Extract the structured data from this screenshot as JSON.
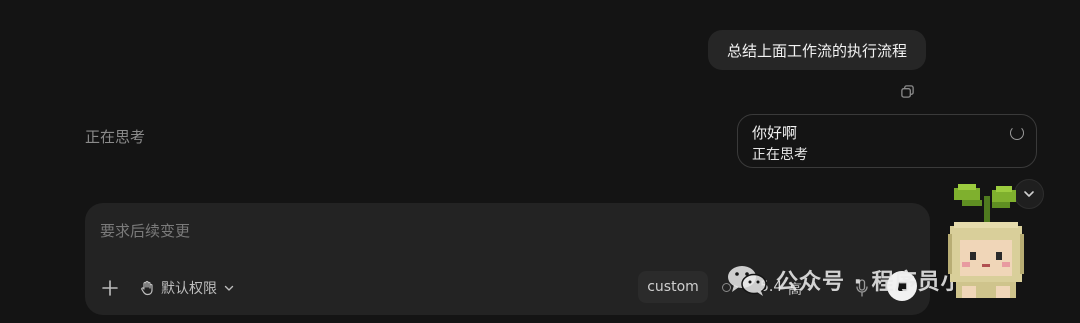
{
  "chat": {
    "user_message": "总结上面工作流的执行流程",
    "thinking_status": "正在思考"
  },
  "status_card": {
    "title": "你好啊",
    "subtitle": "正在思考"
  },
  "composer": {
    "placeholder": "要求后续变更",
    "permission_label": "默认权限",
    "mode_chip": "custom",
    "model_label": "5.4",
    "model_level": "高"
  },
  "watermark": {
    "text": "公众号 · 程序员小溪"
  },
  "icons": {
    "copy": "copy-icon",
    "spinner": "spinner-icon",
    "scroll_down": "chevron-down-icon",
    "plus": "plus-icon",
    "hand": "hand-icon",
    "chevron": "chevron-down-icon",
    "mic": "mic-icon",
    "stop": "stop-icon",
    "wechat": "wechat-icon"
  }
}
